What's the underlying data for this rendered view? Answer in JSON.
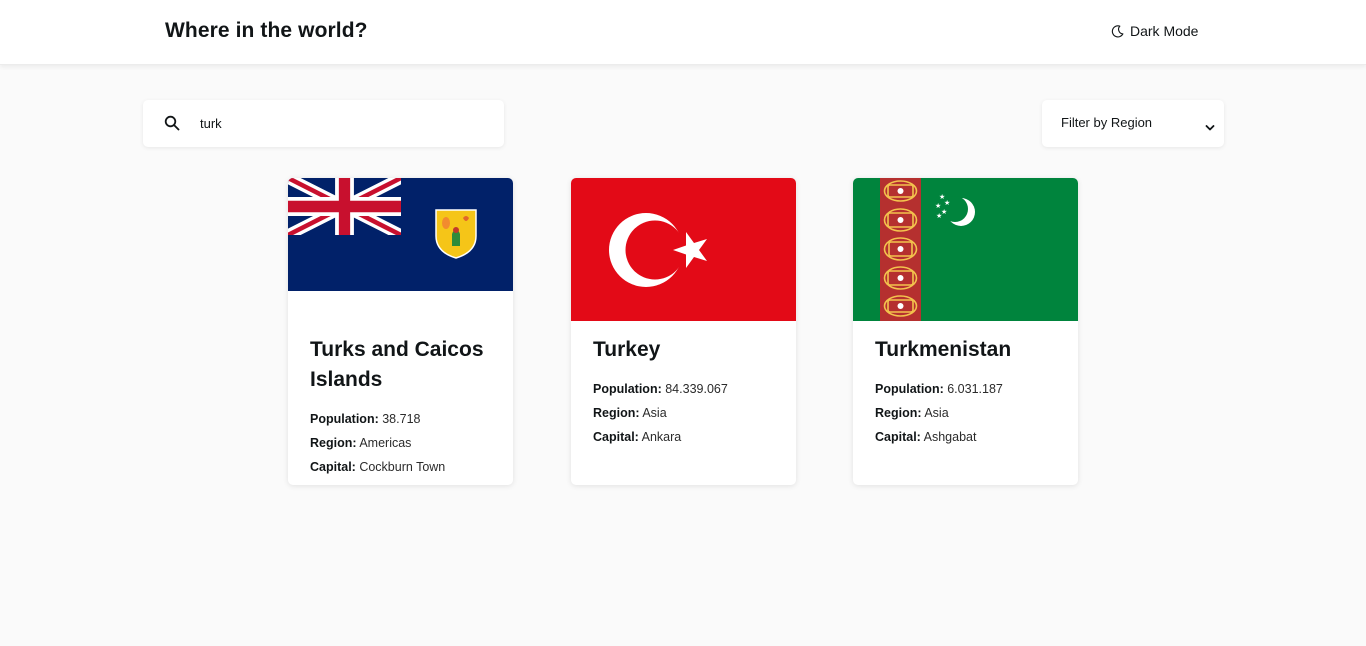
{
  "header": {
    "title": "Where in the world?",
    "dark_mode_label": "Dark Mode"
  },
  "search": {
    "value": "turk",
    "icon": "search-icon"
  },
  "filter": {
    "selected": "Filter by Region"
  },
  "labels": {
    "population": "Population:",
    "region": "Region:",
    "capital": "Capital:"
  },
  "countries": [
    {
      "name": "Turks and Caicos Islands",
      "population": "38.718",
      "region": "Americas",
      "capital": "Cockburn Town",
      "flag": "turks-and-caicos-flag"
    },
    {
      "name": "Turkey",
      "population": "84.339.067",
      "region": "Asia",
      "capital": "Ankara",
      "flag": "turkey-flag"
    },
    {
      "name": "Turkmenistan",
      "population": "6.031.187",
      "region": "Asia",
      "capital": "Ashgabat",
      "flag": "turkmenistan-flag"
    }
  ],
  "colors": {
    "background": "#fafafa",
    "card": "#ffffff",
    "text": "#111517",
    "turkey_red": "#e30a17",
    "turkmenistan_green": "#00843d",
    "tci_blue": "#012169"
  }
}
